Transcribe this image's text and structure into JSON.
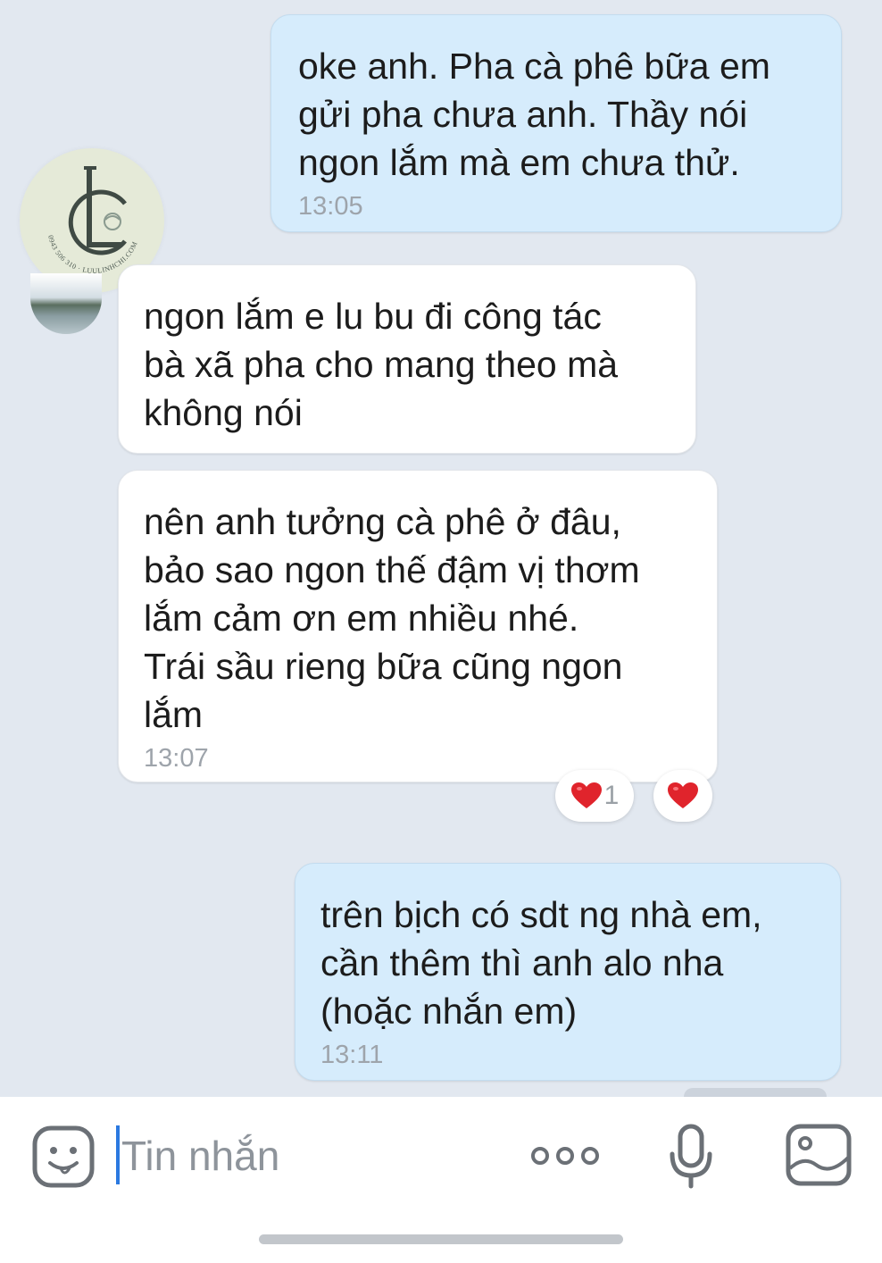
{
  "app": {
    "theme_colors": {
      "outgoing_bubble": "#d6ecfc",
      "incoming_bubble": "#ffffff",
      "background": "#e2e8f0",
      "cursor": "#2b79e0",
      "heart": "#e0242c"
    }
  },
  "logo": {
    "letters": "LC",
    "ring_text": "0943 506 310 · LUULINHCHI.COM"
  },
  "messages": [
    {
      "direction": "outgoing",
      "text": "oke anh. Pha cà phê bữa em\ngửi pha chưa anh. Thầy nói\nngon lắm mà em chưa thử.",
      "time": "13:05"
    },
    {
      "direction": "incoming",
      "text": "ngon lắm e lu bu đi công tác\nbà xã pha cho mang theo mà\nkhông nói",
      "time": ""
    },
    {
      "direction": "incoming",
      "text": "nên anh tưởng cà phê ở đâu,\nbảo sao ngon thế đậm vị thơm\nlắm cảm ơn em nhiều nhé.\nTrái sầu rieng bữa cũng ngon\nlắm",
      "time": "13:07",
      "reactions": {
        "icon": "heart-icon",
        "count": "1"
      }
    },
    {
      "direction": "outgoing",
      "text": "trên bịch có sdt ng nhà em,\ncần thêm thì anh alo nha\n(hoặc nhắn em)",
      "time": "13:11"
    }
  ],
  "composer": {
    "placeholder": "Tin nhắn",
    "icons": [
      "emoji-icon",
      "more-icon",
      "microphone-icon",
      "image-icon"
    ]
  }
}
